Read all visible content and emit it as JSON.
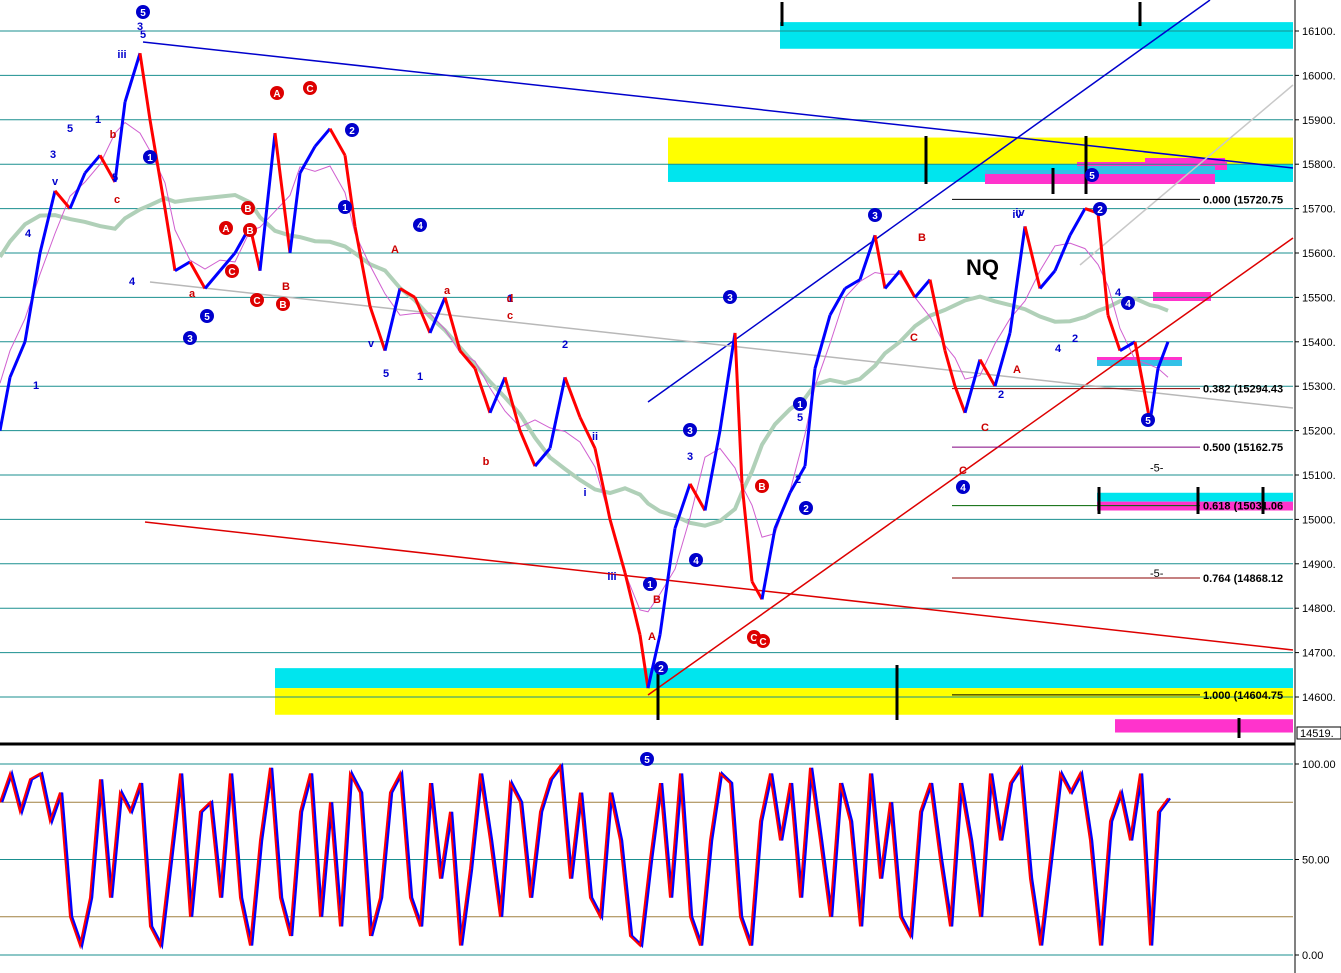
{
  "chart_data": [
    {
      "type": "line",
      "title": "NQ",
      "xlabel": "",
      "ylabel": "",
      "ylim": [
        14510,
        16125
      ],
      "yticks": [
        "16100.",
        "16000.",
        "15900.",
        "15800.",
        "15700.",
        "15600.",
        "15500.",
        "15400.",
        "15300.",
        "15200.",
        "15100.",
        "15000.",
        "14900.",
        "14800.",
        "14700.",
        "14600."
      ],
      "last_price_label": "14519.",
      "grid": true,
      "series_colors": {
        "up": "#0000ff",
        "down": "#ff0000",
        "neutral": "#000000",
        "moving_average": "#b0d0b8",
        "fast_average": "#d060d0"
      },
      "price_path": [
        [
          0,
          15200
        ],
        [
          10,
          15320
        ],
        [
          25,
          15400
        ],
        [
          40,
          15600
        ],
        [
          55,
          15740
        ],
        [
          70,
          15700
        ],
        [
          85,
          15780
        ],
        [
          100,
          15820
        ],
        [
          115,
          15760
        ],
        [
          125,
          15940
        ],
        [
          140,
          16050
        ],
        [
          150,
          15900
        ],
        [
          165,
          15700
        ],
        [
          175,
          15560
        ],
        [
          190,
          15580
        ],
        [
          205,
          15520
        ],
        [
          220,
          15560
        ],
        [
          235,
          15600
        ],
        [
          250,
          15660
        ],
        [
          260,
          15560
        ],
        [
          275,
          15870
        ],
        [
          290,
          15600
        ],
        [
          300,
          15780
        ],
        [
          315,
          15840
        ],
        [
          330,
          15880
        ],
        [
          345,
          15820
        ],
        [
          355,
          15660
        ],
        [
          370,
          15480
        ],
        [
          385,
          15380
        ],
        [
          400,
          15520
        ],
        [
          415,
          15500
        ],
        [
          430,
          15420
        ],
        [
          445,
          15500
        ],
        [
          460,
          15380
        ],
        [
          475,
          15340
        ],
        [
          490,
          15240
        ],
        [
          505,
          15320
        ],
        [
          520,
          15200
        ],
        [
          535,
          15120
        ],
        [
          550,
          15160
        ],
        [
          565,
          15320
        ],
        [
          580,
          15230
        ],
        [
          595,
          15160
        ],
        [
          610,
          15000
        ],
        [
          625,
          14880
        ],
        [
          640,
          14740
        ],
        [
          648,
          14620
        ],
        [
          660,
          14740
        ],
        [
          675,
          14980
        ],
        [
          690,
          15080
        ],
        [
          705,
          15020
        ],
        [
          720,
          15200
        ],
        [
          735,
          15420
        ],
        [
          742,
          15080
        ],
        [
          752,
          14860
        ],
        [
          762,
          14820
        ],
        [
          775,
          14980
        ],
        [
          790,
          15060
        ],
        [
          805,
          15120
        ],
        [
          815,
          15340
        ],
        [
          830,
          15460
        ],
        [
          845,
          15520
        ],
        [
          860,
          15540
        ],
        [
          875,
          15640
        ],
        [
          885,
          15520
        ],
        [
          900,
          15560
        ],
        [
          915,
          15500
        ],
        [
          930,
          15540
        ],
        [
          945,
          15380
        ],
        [
          955,
          15300
        ],
        [
          965,
          15240
        ],
        [
          980,
          15360
        ],
        [
          995,
          15300
        ],
        [
          1010,
          15420
        ],
        [
          1025,
          15660
        ],
        [
          1040,
          15520
        ],
        [
          1055,
          15560
        ],
        [
          1070,
          15640
        ],
        [
          1085,
          15700
        ],
        [
          1098,
          15690
        ],
        [
          1108,
          15460
        ],
        [
          1120,
          15380
        ],
        [
          1135,
          15400
        ],
        [
          1150,
          15220
        ],
        [
          1158,
          15340
        ],
        [
          1168,
          15400
        ]
      ],
      "price_bands": [
        {
          "color": "#00e5ee",
          "from": 15760,
          "to": 15800
        },
        {
          "color": "#ffff00",
          "from": 15800,
          "to": 15860
        },
        {
          "color": "#00e5ee",
          "from": 16060,
          "to": 16120
        },
        {
          "color": "#00e5ee",
          "from": 14620,
          "to": 14665
        },
        {
          "color": "#ffff00",
          "from": 14560,
          "to": 14620
        },
        {
          "color": "#ff33cc",
          "from": 14520,
          "to": 14550
        },
        {
          "color": "#00e5ee",
          "from": 15040,
          "to": 15060
        },
        {
          "color": "#ff33cc",
          "from": 15020,
          "to": 15040
        }
      ],
      "fib_levels": [
        {
          "label": "0.000 (15720.75",
          "value": 15720.75,
          "color": "#000000"
        },
        {
          "label": "0.382 (15294.43",
          "value": 15294.43,
          "color": "#8b0000"
        },
        {
          "label": "0.500 (15162.75",
          "value": 15162.75,
          "color": "#800080"
        },
        {
          "label": "0.618 (15031.06",
          "value": 15031.06,
          "color": "#006400"
        },
        {
          "label": "0.764 (14868.12",
          "value": 14868.12,
          "color": "#8b0000"
        },
        {
          "label": "1.000 (14604.75",
          "value": 14604.75,
          "color": "#000000"
        }
      ],
      "extra_labels": [
        "-5-",
        "-5-"
      ],
      "wave_labels_blue": [
        "5",
        "iii",
        "3",
        "5",
        "1",
        "v",
        "4",
        "iv",
        "2",
        "1",
        "5",
        "3",
        "4",
        "2",
        "1",
        "i",
        "ii",
        "iii",
        "5",
        "v",
        "1",
        "3",
        "4",
        "2",
        "5",
        "4",
        "iv",
        "2"
      ],
      "wave_labels_red": [
        "a",
        "b",
        "c",
        "A",
        "B",
        "C",
        "A",
        "B",
        "C",
        "a",
        "b",
        "c",
        "d",
        "B",
        "A",
        "C"
      ],
      "circled_blue": [
        "5",
        "3",
        "2",
        "1",
        "4",
        "1",
        "2",
        "4",
        "3",
        "5",
        "1",
        "2",
        "3",
        "5",
        "4",
        "5",
        "4",
        "2",
        "1",
        "5",
        "3"
      ],
      "circled_red": [
        "A",
        "C",
        "B",
        "A",
        "B",
        "C",
        "B",
        "C",
        "C",
        "C",
        "B"
      ]
    },
    {
      "type": "line",
      "title": "",
      "ylim": [
        -5,
        105
      ],
      "yticks": [
        "100.00",
        "50.00",
        "0.00"
      ],
      "series_colors": {
        "main": "#ff0000",
        "signal": "#0000ff"
      },
      "oscillator_path": [
        [
          0,
          80
        ],
        [
          10,
          95
        ],
        [
          20,
          75
        ],
        [
          30,
          92
        ],
        [
          40,
          95
        ],
        [
          50,
          70
        ],
        [
          60,
          85
        ],
        [
          70,
          20
        ],
        [
          80,
          5
        ],
        [
          90,
          30
        ],
        [
          100,
          92
        ],
        [
          110,
          30
        ],
        [
          120,
          85
        ],
        [
          130,
          75
        ],
        [
          140,
          90
        ],
        [
          150,
          15
        ],
        [
          160,
          5
        ],
        [
          170,
          50
        ],
        [
          180,
          95
        ],
        [
          190,
          20
        ],
        [
          200,
          75
        ],
        [
          210,
          80
        ],
        [
          220,
          30
        ],
        [
          230,
          95
        ],
        [
          240,
          30
        ],
        [
          250,
          5
        ],
        [
          260,
          60
        ],
        [
          270,
          98
        ],
        [
          280,
          30
        ],
        [
          290,
          10
        ],
        [
          300,
          75
        ],
        [
          310,
          95
        ],
        [
          320,
          20
        ],
        [
          330,
          80
        ],
        [
          340,
          15
        ],
        [
          350,
          95
        ],
        [
          360,
          85
        ],
        [
          370,
          10
        ],
        [
          380,
          30
        ],
        [
          390,
          85
        ],
        [
          400,
          95
        ],
        [
          410,
          30
        ],
        [
          420,
          15
        ],
        [
          430,
          90
        ],
        [
          440,
          40
        ],
        [
          450,
          75
        ],
        [
          460,
          5
        ],
        [
          470,
          45
        ],
        [
          480,
          95
        ],
        [
          490,
          60
        ],
        [
          500,
          20
        ],
        [
          510,
          90
        ],
        [
          520,
          80
        ],
        [
          530,
          30
        ],
        [
          540,
          75
        ],
        [
          550,
          92
        ],
        [
          560,
          99
        ],
        [
          570,
          40
        ],
        [
          580,
          85
        ],
        [
          590,
          30
        ],
        [
          600,
          20
        ],
        [
          610,
          85
        ],
        [
          620,
          60
        ],
        [
          630,
          10
        ],
        [
          640,
          5
        ],
        [
          650,
          50
        ],
        [
          660,
          90
        ],
        [
          670,
          30
        ],
        [
          680,
          95
        ],
        [
          690,
          20
        ],
        [
          700,
          5
        ],
        [
          710,
          60
        ],
        [
          720,
          95
        ],
        [
          730,
          90
        ],
        [
          740,
          20
        ],
        [
          750,
          5
        ],
        [
          760,
          70
        ],
        [
          770,
          95
        ],
        [
          780,
          60
        ],
        [
          790,
          90
        ],
        [
          800,
          30
        ],
        [
          810,
          98
        ],
        [
          820,
          60
        ],
        [
          830,
          20
        ],
        [
          840,
          90
        ],
        [
          850,
          70
        ],
        [
          860,
          15
        ],
        [
          870,
          95
        ],
        [
          880,
          40
        ],
        [
          890,
          80
        ],
        [
          900,
          20
        ],
        [
          910,
          10
        ],
        [
          920,
          75
        ],
        [
          930,
          90
        ],
        [
          940,
          50
        ],
        [
          950,
          15
        ],
        [
          960,
          90
        ],
        [
          970,
          60
        ],
        [
          980,
          20
        ],
        [
          990,
          95
        ],
        [
          1000,
          60
        ],
        [
          1010,
          90
        ],
        [
          1020,
          98
        ],
        [
          1030,
          40
        ],
        [
          1040,
          5
        ],
        [
          1050,
          50
        ],
        [
          1060,
          95
        ],
        [
          1070,
          85
        ],
        [
          1080,
          95
        ],
        [
          1090,
          60
        ],
        [
          1100,
          5
        ],
        [
          1110,
          70
        ],
        [
          1120,
          85
        ],
        [
          1130,
          60
        ],
        [
          1140,
          95
        ],
        [
          1150,
          5
        ],
        [
          1158,
          75
        ],
        [
          1168,
          82
        ]
      ]
    }
  ]
}
